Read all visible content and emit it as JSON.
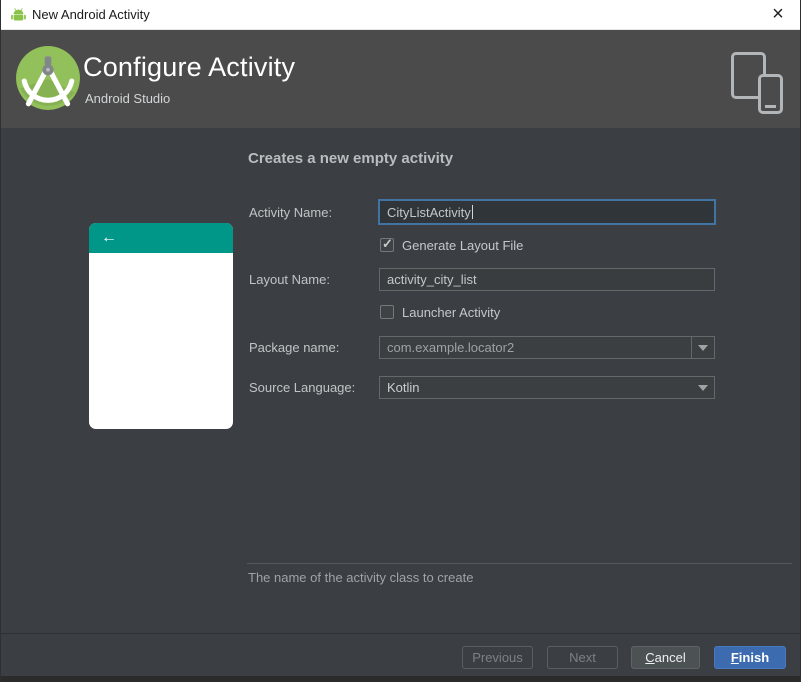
{
  "titlebar": {
    "title": "New Android Activity"
  },
  "header": {
    "title": "Configure Activity",
    "subtitle": "Android Studio"
  },
  "main": {
    "heading": "Creates a new empty activity",
    "hint": "The name of the activity class to create",
    "form": {
      "activity_name": {
        "label": "Activity Name:",
        "value": "CityListActivity"
      },
      "generate_layout": {
        "label": "Generate Layout File",
        "checked": true
      },
      "layout_name": {
        "label": "Layout Name:",
        "value": "activity_city_list"
      },
      "launcher_activity": {
        "label": "Launcher Activity",
        "checked": false
      },
      "package_name": {
        "label": "Package name:",
        "value": "com.example.locator2"
      },
      "source_language": {
        "label": "Source Language:",
        "value": "Kotlin"
      }
    }
  },
  "footer": {
    "previous": {
      "label": "Previous",
      "enabled": false
    },
    "next": {
      "label": "Next",
      "enabled": false
    },
    "cancel": {
      "label": "Cancel",
      "enabled": true
    },
    "finish": {
      "label": "Finish",
      "enabled": true
    }
  },
  "icons": {
    "close": "×",
    "back_arrow": "←",
    "checkmark": "✓"
  },
  "colors": {
    "accent_teal": "#009688",
    "finish_blue": "#3c6bb0",
    "focus_blue": "#4173a3",
    "logo_green": "#92c05a",
    "titlebar_bg": "#ffffff",
    "header_bg": "#4b4b4b",
    "content_bg": "#3b3f43"
  }
}
